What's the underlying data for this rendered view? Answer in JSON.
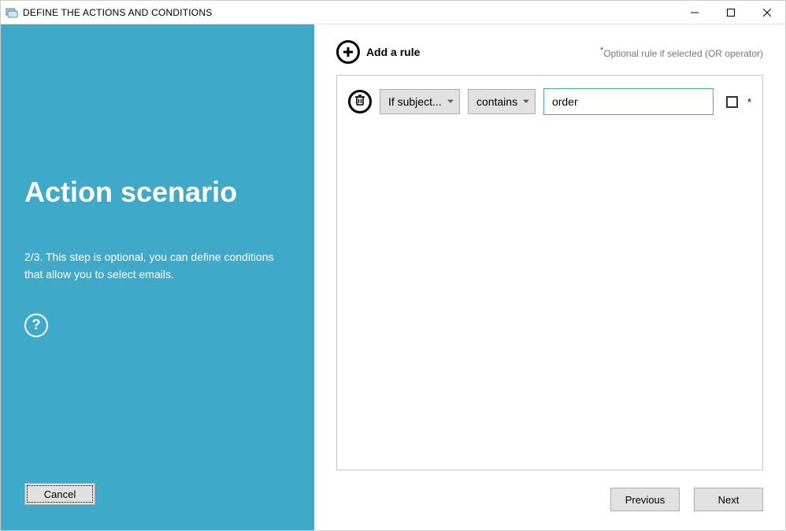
{
  "window": {
    "title": "DEFINE THE ACTIONS AND CONDITIONS"
  },
  "sidebar": {
    "heading": "Action scenario",
    "description": "2/3. This step is optional, you can define conditions that allow you to select emails.",
    "help_glyph": "?",
    "cancel_label": "Cancel"
  },
  "main": {
    "add_rule_label": "Add a rule",
    "optional_note_prefix": "*",
    "optional_note_text": "Optional rule if selected (OR operator)",
    "rule": {
      "field_label": "If subject...",
      "operator_label": "contains",
      "value": "order",
      "optional_star": "*"
    },
    "previous_label": "Previous",
    "next_label": "Next"
  }
}
